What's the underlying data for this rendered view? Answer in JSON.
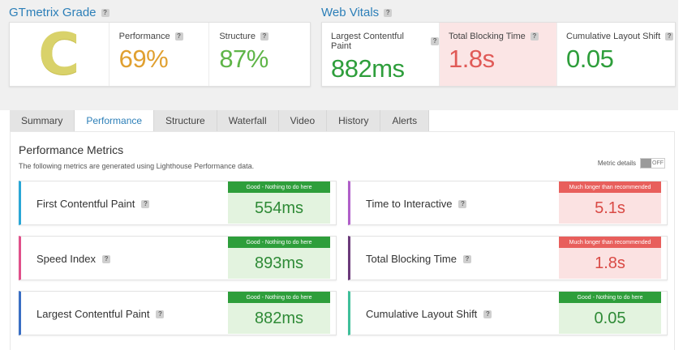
{
  "grade_section": {
    "title": "GTmetrix Grade",
    "grade": "C",
    "grade_color": "#d9d26a",
    "performance": {
      "label": "Performance",
      "value": "69%",
      "color": "#e0a030"
    },
    "structure": {
      "label": "Structure",
      "value": "87%",
      "color": "#5fb548"
    }
  },
  "vitals_section": {
    "title": "Web Vitals",
    "items": [
      {
        "label": "Largest Contentful Paint",
        "value": "882ms",
        "color": "#2e9e3b"
      },
      {
        "label": "Total Blocking Time",
        "value": "1.8s",
        "color": "#e05a57"
      },
      {
        "label": "Cumulative Layout Shift",
        "value": "0.05",
        "color": "#2e9e3b"
      }
    ]
  },
  "tabs": [
    "Summary",
    "Performance",
    "Structure",
    "Waterfall",
    "Video",
    "History",
    "Alerts"
  ],
  "active_tab": "Performance",
  "panel": {
    "title": "Performance Metrics",
    "subtitle": "The following metrics are generated using Lighthouse Performance data.",
    "metric_details_label": "Metric details",
    "toggle_label": "OFF"
  },
  "metrics_left": [
    {
      "name": "First Contentful Paint",
      "badge": "Good - Nothing to do here",
      "value": "554ms",
      "status": "good",
      "accent": "#2aa7d6"
    },
    {
      "name": "Speed Index",
      "badge": "Good - Nothing to do here",
      "value": "893ms",
      "status": "good",
      "accent": "#e0508a"
    },
    {
      "name": "Largest Contentful Paint",
      "badge": "Good - Nothing to do here",
      "value": "882ms",
      "status": "good",
      "accent": "#3a6fc4"
    }
  ],
  "metrics_right": [
    {
      "name": "Time to Interactive",
      "badge": "Much longer than recommended",
      "value": "5.1s",
      "status": "bad",
      "accent": "#b05fc9"
    },
    {
      "name": "Total Blocking Time",
      "badge": "Much longer than recommended",
      "value": "1.8s",
      "status": "bad",
      "accent": "#6b3a7a"
    },
    {
      "name": "Cumulative Layout Shift",
      "badge": "Good - Nothing to do here",
      "value": "0.05",
      "status": "good",
      "accent": "#3fbf9a"
    }
  ]
}
